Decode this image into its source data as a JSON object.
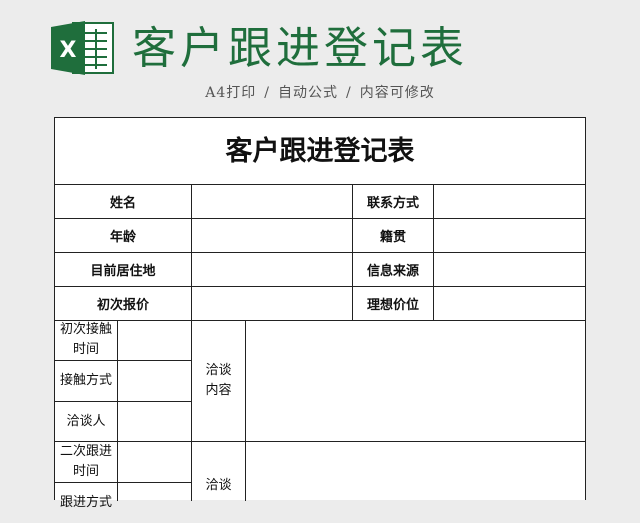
{
  "banner": {
    "title": "客户跟进登记表",
    "logo_letter": "X",
    "brand_color": "#1f6e3c",
    "subtitle_parts": [
      "A4打印",
      "/",
      "自动公式",
      "/",
      "内容可修改"
    ]
  },
  "sheet": {
    "title": "客户跟进登记表",
    "info_rows": [
      {
        "left_label": "姓名",
        "right_label": "联系方式"
      },
      {
        "left_label": "年龄",
        "right_label": "籍贯"
      },
      {
        "left_label": "目前居住地",
        "right_label": "信息来源"
      },
      {
        "left_label": "初次报价",
        "right_label": "理想价位"
      }
    ],
    "first_contact": {
      "time_label": "初次接触时间",
      "method_label": "接触方式",
      "person_label": "洽谈人",
      "content_label": "洽谈内容"
    },
    "second_contact": {
      "time_label": "二次跟进时间",
      "method_label": "跟进方式",
      "content_label": "洽谈"
    }
  }
}
